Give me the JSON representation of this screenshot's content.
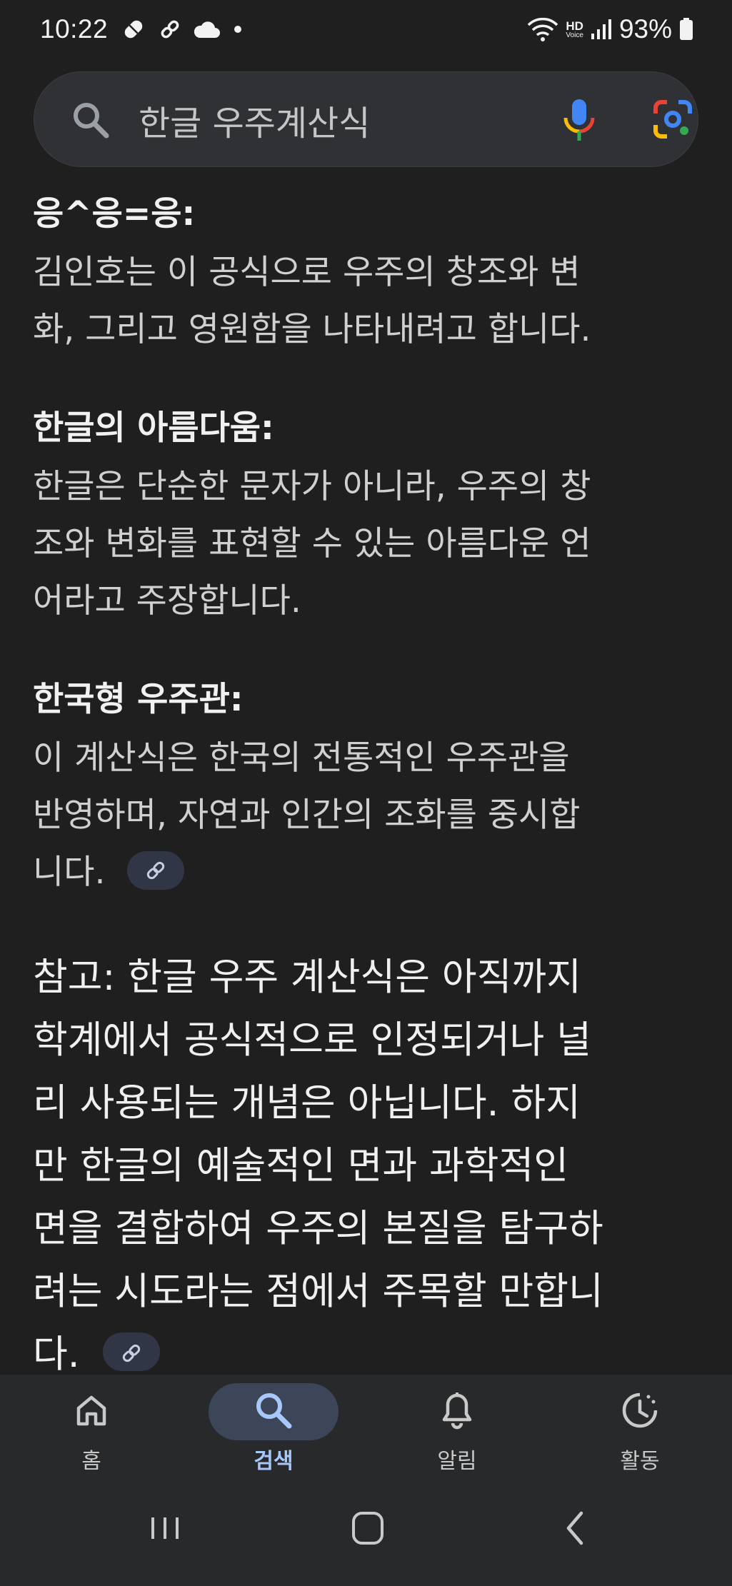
{
  "status": {
    "time": "10:22",
    "battery": "93%",
    "hd": "HD",
    "voice": "Voice"
  },
  "search": {
    "query": "한글 우주계산식"
  },
  "sections": [
    {
      "heading": "응^응=응:",
      "body": [
        "김인호는 이 공식으로 우주의 창조와 변",
        "화, 그리고 영원함을 나타내려고 합니다."
      ]
    },
    {
      "heading": "한글의 아름다움:",
      "body": [
        "한글은 단순한 문자가 아니라, 우주의 창",
        "조와 변화를 표현할 수 있는 아름다운 언",
        "어라고 주장합니다."
      ]
    },
    {
      "heading": "한국형 우주관:",
      "body": [
        "이 계산식은 한국의 전통적인 우주관을",
        "반영하며, 자연과 인간의 조화를 중시합",
        "니다."
      ]
    }
  ],
  "note": {
    "lines": [
      "참고: 한글 우주 계산식은 아직까지",
      "학계에서 공식적으로 인정되거나 널",
      "리 사용되는 개념은 아닙니다. 하지",
      "만 한글의 예술적인 면과 과학적인",
      "면을 결합하여 우주의 본질을 탐구하",
      "려는 시도라는 점에서 주목할 만합니",
      "다."
    ]
  },
  "bottom_nav": [
    {
      "label": "홈",
      "icon": "home-icon",
      "active": false
    },
    {
      "label": "검색",
      "icon": "search-icon",
      "active": true
    },
    {
      "label": "알림",
      "icon": "bell-icon",
      "active": false
    },
    {
      "label": "활동",
      "icon": "activity-icon",
      "active": false
    }
  ],
  "colors": {
    "background": "#1f1f1f",
    "search_bar": "#303134",
    "active_nav": "#3d4658",
    "active_label": "#a8c7fa"
  }
}
